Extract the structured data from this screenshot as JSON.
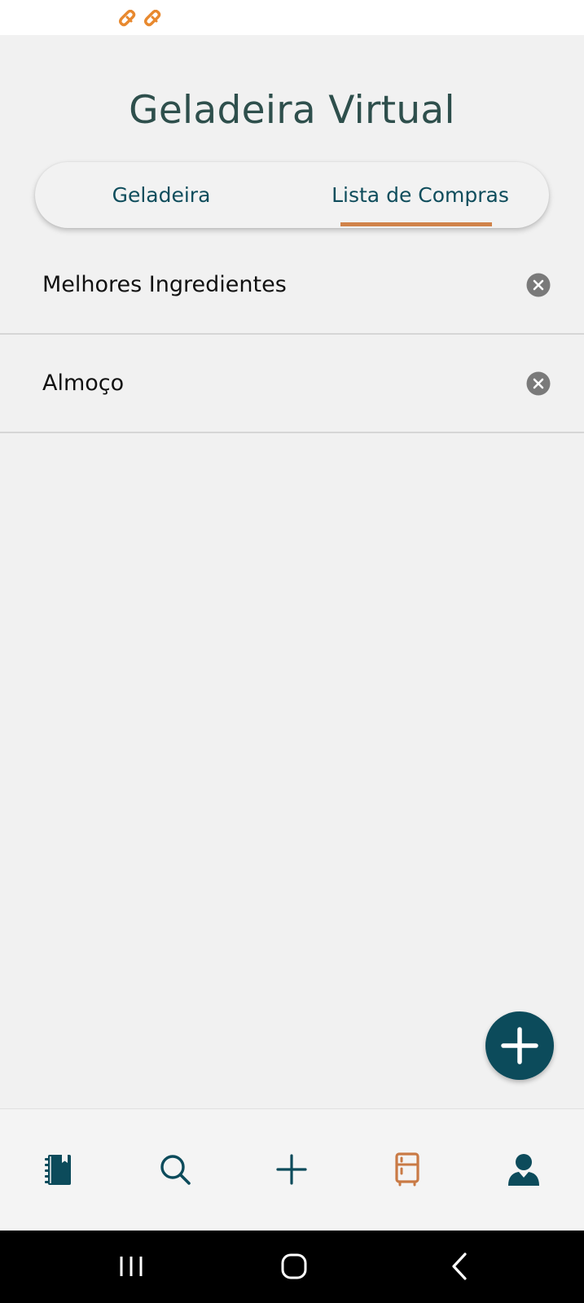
{
  "status_bar": {
    "notification_icons": [
      "orange-heart-icon",
      "orange-heart-icon"
    ]
  },
  "header": {
    "title": "Geladeira Virtual"
  },
  "tabs": [
    {
      "label": "Geladeira",
      "active": false
    },
    {
      "label": "Lista de Compras",
      "active": true
    }
  ],
  "shopping_lists": [
    {
      "name": "Melhores Ingredientes",
      "action_icon": "remove-circle-icon"
    },
    {
      "name": "Almoço",
      "action_icon": "remove-circle-icon"
    }
  ],
  "fab": {
    "icon": "plus-icon"
  },
  "bottom_nav": {
    "items": [
      {
        "icon": "recipe-book-icon",
        "active": false
      },
      {
        "icon": "search-icon",
        "active": false
      },
      {
        "icon": "plus-icon",
        "active": false
      },
      {
        "icon": "fridge-icon",
        "active": true
      },
      {
        "icon": "profile-icon",
        "active": false
      }
    ]
  },
  "system_nav": {
    "buttons": [
      "recent-apps-icon",
      "home-icon",
      "back-icon"
    ]
  },
  "colors": {
    "primary": "#0c4b5b",
    "accent": "#d0834a",
    "title": "#2e4f4c",
    "background": "#f1f1f1"
  }
}
